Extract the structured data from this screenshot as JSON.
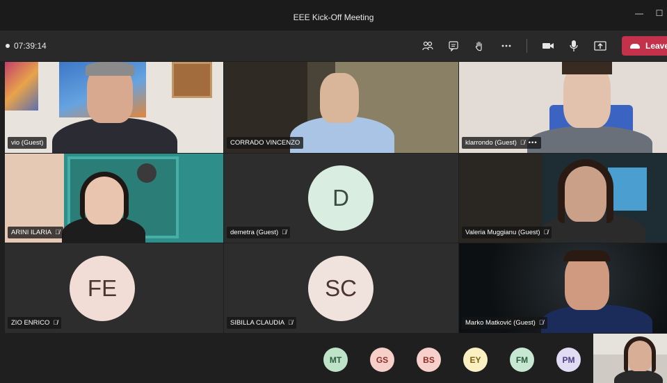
{
  "window": {
    "title": "EEE Kick-Off Meeting",
    "minimize": "—",
    "maximize": "☐"
  },
  "toolbar": {
    "timer": "07:39:14",
    "leave_label": "Leave",
    "icons": [
      "participants-icon",
      "chat-icon",
      "raise-hand-icon",
      "more-icon",
      "camera-icon",
      "mic-icon",
      "share-icon"
    ]
  },
  "participants": [
    {
      "name": "vio (Guest)",
      "muted": false,
      "type": "video"
    },
    {
      "name": "CORRADO VINCENZO",
      "muted": false,
      "type": "video"
    },
    {
      "name": "klarrondo (Guest)",
      "muted": true,
      "type": "video",
      "more": "•••"
    },
    {
      "name": "ARINI ILARIA",
      "muted": true,
      "type": "video"
    },
    {
      "name": "demetra (Guest)",
      "muted": true,
      "type": "avatar",
      "initials": "D",
      "color": "#d9eee0"
    },
    {
      "name": "Valeria Muggianu (Guest)",
      "muted": true,
      "type": "video"
    },
    {
      "name": "ZIO ENRICO",
      "muted": true,
      "type": "avatar",
      "initials": "FE",
      "color": "#f1ddd5"
    },
    {
      "name": "SIBILLA CLAUDIA",
      "muted": true,
      "type": "avatar",
      "initials": "SC",
      "color": "#f0e2dc"
    },
    {
      "name": "Marko Matković (Guest)",
      "muted": true,
      "type": "video"
    }
  ],
  "overflow_avatars": [
    {
      "initials": "MT",
      "bg": "#bfe3c9",
      "fg": "#2b5b3a"
    },
    {
      "initials": "GS",
      "bg": "#f7cfc9",
      "fg": "#8a2f27"
    },
    {
      "initials": "BS",
      "bg": "#f7cfcb",
      "fg": "#8a2f27"
    },
    {
      "initials": "EY",
      "bg": "#fbf0c2",
      "fg": "#7a5e0c"
    },
    {
      "initials": "FM",
      "bg": "#c6e8d2",
      "fg": "#2b5b3a"
    },
    {
      "initials": "PM",
      "bg": "#e1dcf4",
      "fg": "#4a3f88"
    }
  ],
  "mic_glyph": "🎙̸"
}
